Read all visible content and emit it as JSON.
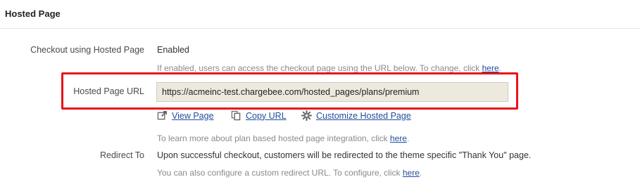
{
  "section": {
    "title": "Hosted Page"
  },
  "checkout": {
    "label": "Checkout using Hosted Page",
    "value": "Enabled",
    "help_text": "If enabled, users can access the checkout page using the URL below. To change, click",
    "help_link": "here",
    "help_suffix": "."
  },
  "hosted_url": {
    "label": "Hosted Page URL",
    "value": "https://acmeinc-test.chargebee.com/hosted_pages/plans/premium"
  },
  "actions": {
    "view_page": "View Page",
    "copy_url": "Copy URL",
    "customize": "Customize Hosted Page"
  },
  "learn_more": {
    "text": "To learn more about plan based hosted page integration, click",
    "link": "here",
    "suffix": "."
  },
  "redirect": {
    "label": "Redirect To",
    "text": "Upon successful checkout, customers will be redirected to the theme specific \"Thank You\" page.",
    "help_text": "You can also configure a custom redirect URL. To configure, click",
    "help_link": "here",
    "help_suffix": "."
  },
  "colors": {
    "link": "#1f4e9c",
    "highlight": "#e8141a",
    "input_bg": "#ede9df"
  },
  "icons": [
    "external-link-icon",
    "copy-icon",
    "gear-icon"
  ]
}
